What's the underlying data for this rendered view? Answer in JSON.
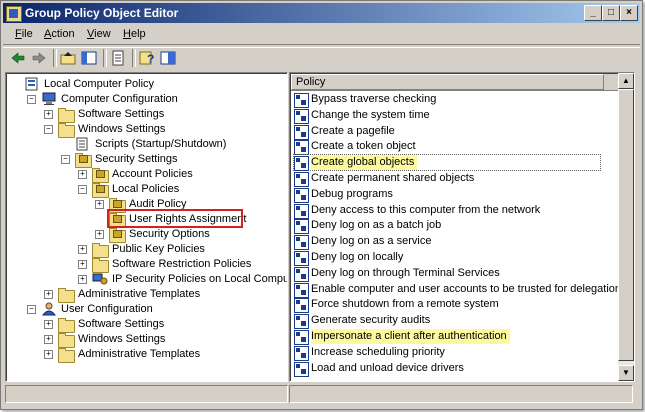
{
  "window": {
    "title": "Group Policy Object Editor"
  },
  "titlebar_buttons": [
    "_",
    "□",
    "×"
  ],
  "menu": [
    {
      "pre": "",
      "u": "F",
      "post": "ile"
    },
    {
      "pre": "",
      "u": "A",
      "post": "ction"
    },
    {
      "pre": "",
      "u": "V",
      "post": "iew"
    },
    {
      "pre": "",
      "u": "H",
      "post": "elp"
    }
  ],
  "toolbar": [
    "back-icon",
    "forward-icon",
    "up-folder-icon",
    "show-hide-tree-icon",
    "export-list-icon",
    "help-icon",
    "properties-icon"
  ],
  "tree": [
    {
      "label": "Local Computer Policy",
      "level": 0,
      "exp": "",
      "icon": "policy-root"
    },
    {
      "label": "Computer Configuration",
      "level": 1,
      "exp": "-",
      "icon": "computer"
    },
    {
      "label": "Software Settings",
      "level": 2,
      "exp": "+",
      "icon": "folder"
    },
    {
      "label": "Windows Settings",
      "level": 2,
      "exp": "-",
      "icon": "folder"
    },
    {
      "label": "Scripts (Startup/Shutdown)",
      "level": 3,
      "exp": "",
      "icon": "script"
    },
    {
      "label": "Security Settings",
      "level": 3,
      "exp": "-",
      "icon": "secfolder"
    },
    {
      "label": "Account Policies",
      "level": 4,
      "exp": "+",
      "icon": "secfolder"
    },
    {
      "label": "Local Policies",
      "level": 4,
      "exp": "-",
      "icon": "secfolder"
    },
    {
      "label": "Audit Policy",
      "level": 5,
      "exp": "+",
      "icon": "secfolder"
    },
    {
      "label": "User Rights Assignment",
      "level": 5,
      "exp": "",
      "icon": "secfolder",
      "selected": true
    },
    {
      "label": "Security Options",
      "level": 5,
      "exp": "+",
      "icon": "secfolder"
    },
    {
      "label": "Public Key Policies",
      "level": 4,
      "exp": "+",
      "icon": "folder"
    },
    {
      "label": "Software Restriction Policies",
      "level": 4,
      "exp": "+",
      "icon": "folder"
    },
    {
      "label": "IP Security Policies on Local Computer",
      "level": 4,
      "exp": "+",
      "icon": "ipsec"
    },
    {
      "label": "Administrative Templates",
      "level": 2,
      "exp": "+",
      "icon": "folder"
    },
    {
      "label": "User Configuration",
      "level": 1,
      "exp": "-",
      "icon": "user"
    },
    {
      "label": "Software Settings",
      "level": 2,
      "exp": "+",
      "icon": "folder"
    },
    {
      "label": "Windows Settings",
      "level": 2,
      "exp": "+",
      "icon": "folder"
    },
    {
      "label": "Administrative Templates",
      "level": 2,
      "exp": "+",
      "icon": "folder"
    }
  ],
  "list": {
    "header": "Policy",
    "items": [
      {
        "label": "Bypass traverse checking"
      },
      {
        "label": "Change the system time"
      },
      {
        "label": "Create a pagefile"
      },
      {
        "label": "Create a token object"
      },
      {
        "label": "Create global objects",
        "highlight": true,
        "focused": true
      },
      {
        "label": "Create permanent shared objects"
      },
      {
        "label": "Debug programs"
      },
      {
        "label": "Deny access to this computer from the network"
      },
      {
        "label": "Deny log on as a batch job"
      },
      {
        "label": "Deny log on as a service"
      },
      {
        "label": "Deny log on locally"
      },
      {
        "label": "Deny log on through Terminal Services"
      },
      {
        "label": "Enable computer and user accounts to be trusted for delegation"
      },
      {
        "label": "Force shutdown from a remote system"
      },
      {
        "label": "Generate security audits"
      },
      {
        "label": "Impersonate a client after authentication",
        "highlight": true
      },
      {
        "label": "Increase scheduling priority"
      },
      {
        "label": "Load and unload device drivers"
      }
    ]
  },
  "colors": {
    "highlight": "#fcfa9c",
    "selection_box": "#d42020",
    "titlebar_start": "#0a246a",
    "titlebar_end": "#a6caf0"
  }
}
